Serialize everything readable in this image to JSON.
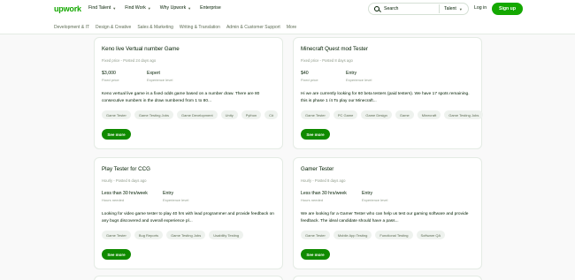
{
  "header": {
    "logo": "upwork",
    "nav": [
      {
        "label": "Find Talent",
        "has_dropdown": true
      },
      {
        "label": "Find Work",
        "has_dropdown": true
      },
      {
        "label": "Why Upwork",
        "has_dropdown": true
      },
      {
        "label": "Enterprise",
        "has_dropdown": false
      }
    ],
    "search": {
      "placeholder": "Search",
      "scope": "Talent"
    },
    "login_label": "Log in",
    "signup_label": "Sign up"
  },
  "categories": [
    "Development & IT",
    "Design & Creative",
    "Sales & Marketing",
    "Writing & Translation",
    "Admin & Customer Support",
    "More"
  ],
  "jobs": [
    {
      "title": "Keno live Vertual number Game",
      "meta": "Fixed price - Posted 24 days ago",
      "field1_value": "$3,000",
      "field1_label": "Fixed price",
      "field2_value": "Expert",
      "field2_label": "Experience level",
      "description": "Keno vertual live game is a fixed odds game based on a number draw. There are 80 consecutive numbers in the draw numbered from 1 to 80...",
      "tags": [
        "Game Tester",
        "Game Testing Jobs",
        "Game Development",
        "Unity",
        "Python",
        "C#"
      ],
      "see_more": "See more"
    },
    {
      "title": "Minecraft Quest mod Tester",
      "meta": "Fixed price - Posted 8 days ago",
      "field1_value": "$40",
      "field1_label": "Fixed price",
      "field2_value": "Entry",
      "field2_label": "Experience level",
      "description": "Hi we are currently looking for 60 beta testers (paid testers). We have 17 spots remaining. this is phase 1 /4 To play our Minecraft...",
      "tags": [
        "Game Tester",
        "PC Game",
        "Game Design",
        "Game",
        "Minecraft",
        "Game Testing Jobs"
      ],
      "see_more": "See more"
    },
    {
      "title": "Play Tester for CCG",
      "meta": "Hourly - Posted 6 days ago",
      "field1_value": "Less than 30 hrs/week",
      "field1_label": "Hours needed",
      "field2_value": "Entry",
      "field2_label": "Experience level",
      "description": "Looking for video game tester to play 40 hrs with lead programmer and provide feedback on any bugs discovered and overall experience pl...",
      "tags": [
        "Game Tester",
        "Bug Reports",
        "Game Testing Jobs",
        "Usability Testing"
      ],
      "see_more": "See more"
    },
    {
      "title": "Gamer Tester",
      "meta": "Hourly - Posted 8 days ago",
      "field1_value": "Less than 30 hrs/week",
      "field1_label": "Hours needed",
      "field2_value": "Entry",
      "field2_label": "Experience level",
      "description": "We are looking for a Gamer Tester who can help us test our gaming software and provide feedback. The ideal candidate should have a pass...",
      "tags": [
        "Game Tester",
        "Mobile App Testing",
        "Functional Testing",
        "Software QA"
      ],
      "see_more": "See more"
    }
  ]
}
